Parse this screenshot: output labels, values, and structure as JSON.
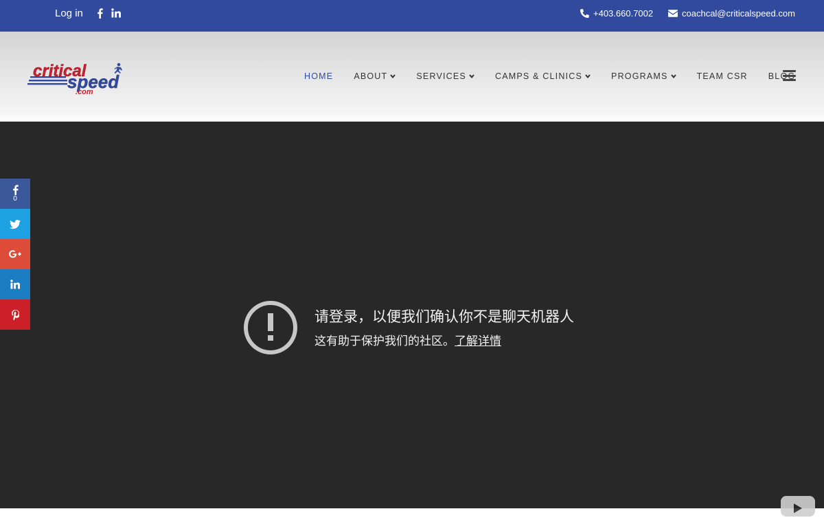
{
  "topbar": {
    "login_label": "Log in",
    "phone": "+403.660.7002",
    "email": "coachcal@criticalspeed.com",
    "background": "#324a9e"
  },
  "logo": {
    "line1": "critical",
    "line2": "speed",
    "line3": ".com"
  },
  "nav": {
    "items": [
      {
        "label": "HOME",
        "active": true,
        "dropdown": false
      },
      {
        "label": "ABOUT",
        "active": false,
        "dropdown": true
      },
      {
        "label": "SERVICES",
        "active": false,
        "dropdown": true
      },
      {
        "label": "CAMPS & CLINICS",
        "active": false,
        "dropdown": true
      },
      {
        "label": "PROGRAMS",
        "active": false,
        "dropdown": true
      },
      {
        "label": "TEAM CSR",
        "active": false,
        "dropdown": false
      },
      {
        "label": "BLOG",
        "active": false,
        "dropdown": false
      }
    ],
    "active_color": "#324a9e",
    "menu_icon": "hamburger-icon"
  },
  "video": {
    "title": "请登录，以便我们确认你不是聊天机器人",
    "subtitle": "这有助于保护我们的社区。",
    "learn_more": "了解详情",
    "background": "#282828"
  },
  "share_bar": {
    "facebook_count": "0",
    "buttons": [
      {
        "icon": "facebook-icon",
        "color": "#3b5998"
      },
      {
        "icon": "twitter-icon",
        "color": "#1da1e2"
      },
      {
        "icon": "google-plus-icon",
        "color": "#dd4b39"
      },
      {
        "icon": "linkedin-icon",
        "color": "#1b7ec2"
      },
      {
        "icon": "pinterest-icon",
        "color": "#cb2027"
      }
    ]
  }
}
